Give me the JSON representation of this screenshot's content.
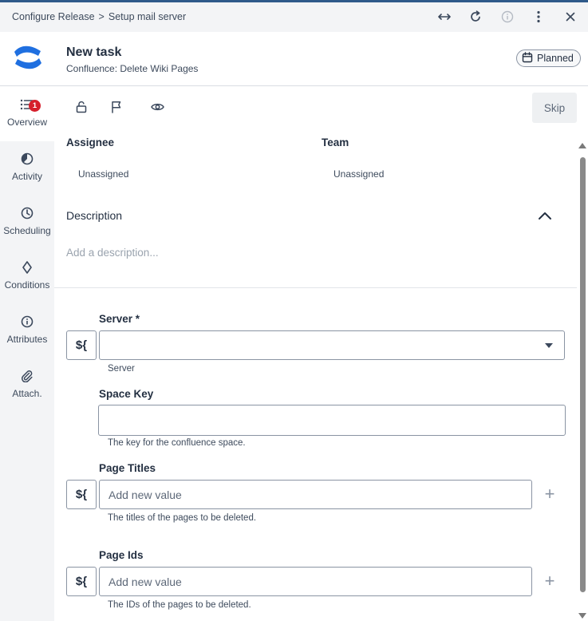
{
  "colors": {
    "accent_bar": "#2f5a8a",
    "badge": "#d61f2c",
    "logo_blue": "#1f6fe0",
    "sidebar_bg": "#f3f4f6"
  },
  "titlebar": {
    "breadcrumb": [
      "Configure Release",
      "Setup mail server"
    ],
    "separator": ">",
    "icons": [
      "expand-horizontal-icon",
      "refresh-icon",
      "info-icon",
      "more-vertical-icon",
      "close-icon"
    ]
  },
  "header": {
    "title": "New task",
    "subtitle": "Confluence: Delete Wiki Pages",
    "status": "Planned",
    "status_icon": "calendar-icon"
  },
  "sidebar": {
    "items": [
      {
        "label": "Overview",
        "icon": "list-icon",
        "badge": "1",
        "active": true
      },
      {
        "label": "Activity",
        "icon": "pie-chart-icon"
      },
      {
        "label": "Scheduling",
        "icon": "clock-icon"
      },
      {
        "label": "Conditions",
        "icon": "diamond-icon"
      },
      {
        "label": "Attributes",
        "icon": "info-icon"
      },
      {
        "label": "Attach.",
        "icon": "paperclip-icon"
      }
    ]
  },
  "toolbar": {
    "icons": [
      "lock-open-icon",
      "flag-icon",
      "eye-icon"
    ],
    "skip_label": "Skip"
  },
  "assignee": {
    "label": "Assignee",
    "value": "Unassigned"
  },
  "team": {
    "label": "Team",
    "value": "Unassigned"
  },
  "description": {
    "label": "Description",
    "placeholder": "Add a description..."
  },
  "fields": {
    "server": {
      "label": "Server *",
      "value": "",
      "helper": "Server",
      "var_button": "${"
    },
    "space_key": {
      "label": "Space Key",
      "value": "",
      "helper": "The key for the confluence space."
    },
    "page_titles": {
      "label": "Page Titles",
      "placeholder": "Add new value",
      "helper": "The titles of the pages to be deleted.",
      "var_button": "${",
      "add": "+"
    },
    "page_ids": {
      "label": "Page Ids",
      "placeholder": "Add new value",
      "helper": "The IDs of the pages to be deleted.",
      "var_button": "${",
      "add": "+"
    }
  }
}
